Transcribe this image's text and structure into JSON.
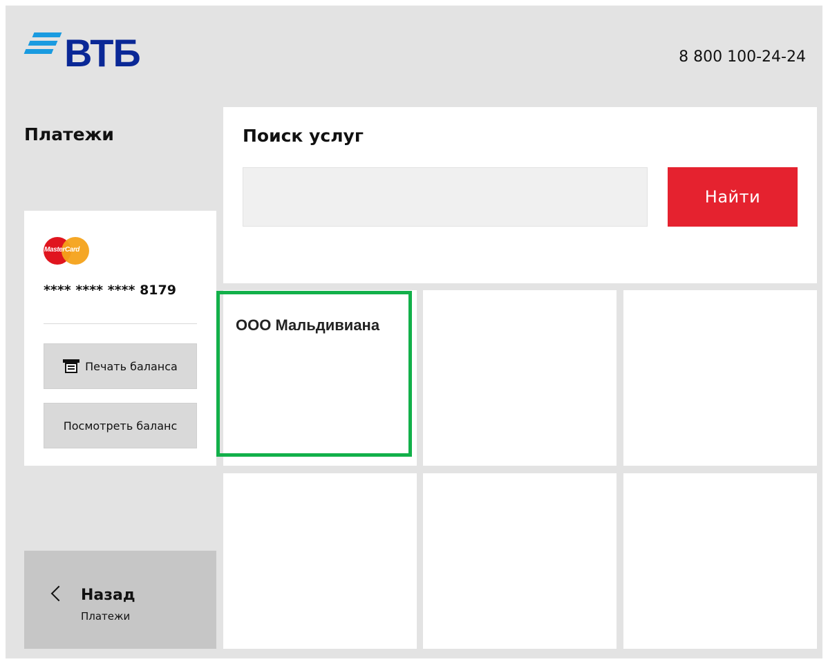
{
  "header": {
    "logo_text": "ВТБ",
    "phone": "8 800 100-24-24"
  },
  "sidebar": {
    "title": "Платежи",
    "card": {
      "brand": "MasterCard",
      "number": "**** **** **** 8179"
    },
    "buttons": {
      "print_balance": "Печать баланса",
      "view_balance": "Посмотреть баланс"
    },
    "back": {
      "label": "Назад",
      "sub": "Платежи"
    }
  },
  "search": {
    "title": "Поиск услуг",
    "value": "",
    "button_label": "Найти"
  },
  "tiles": [
    {
      "label": "ООО Мальдивиана",
      "highlighted": true
    },
    {
      "label": ""
    },
    {
      "label": ""
    },
    {
      "label": ""
    },
    {
      "label": ""
    },
    {
      "label": ""
    }
  ],
  "colors": {
    "brand_blue": "#0a2896",
    "logo_stripes": "#1a9be0",
    "accent_red": "#e5222f",
    "highlight_green": "#12b04a",
    "background": "#e3e3e3"
  },
  "icons": [
    "mastercard-logo",
    "printer-icon",
    "chevron-left-icon"
  ]
}
